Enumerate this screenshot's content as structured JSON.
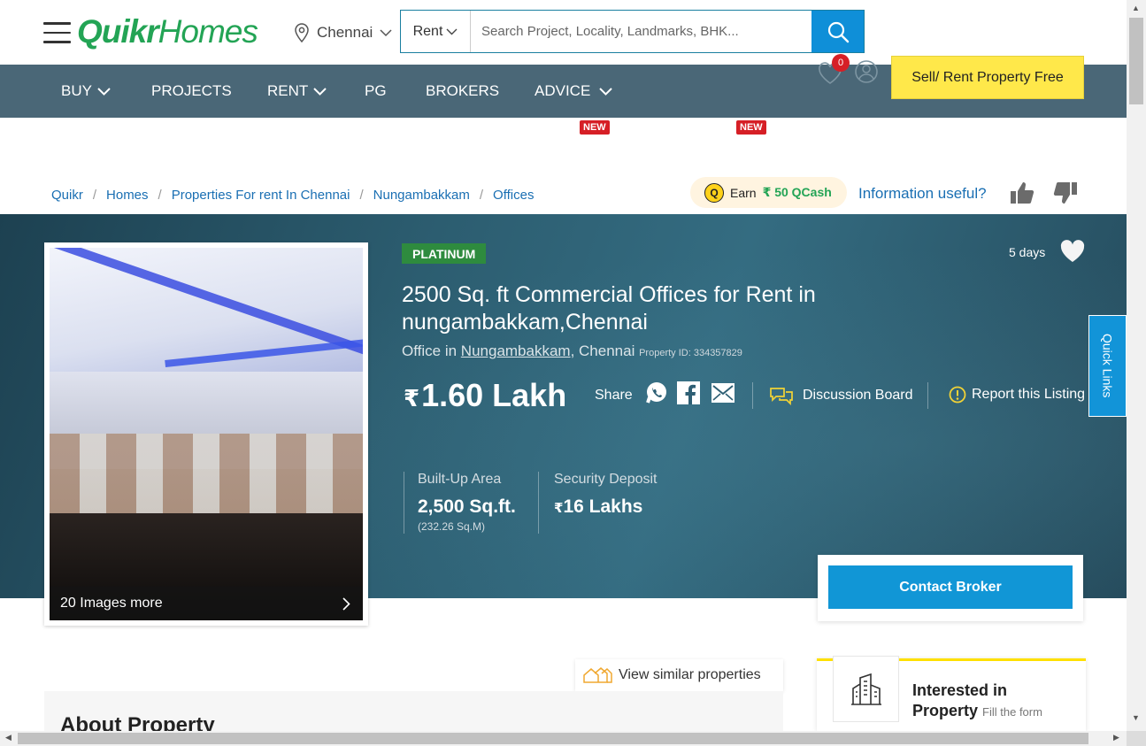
{
  "header": {
    "logo_quikr": "Quikr",
    "logo_homes": "Homes",
    "city": "Chennai",
    "search_type": "Rent",
    "search_placeholder": "Search Project, Locality, Landmarks, BHK...",
    "favorites_count": "0",
    "sell_button": "Sell/ Rent Property Free"
  },
  "nav": {
    "items": [
      {
        "label": "BUY",
        "has_dropdown": true
      },
      {
        "label": "PROJECTS",
        "has_dropdown": false
      },
      {
        "label": "RENT",
        "has_dropdown": true
      },
      {
        "label": "PG",
        "has_dropdown": false
      },
      {
        "label": "BROKERS",
        "has_dropdown": false
      },
      {
        "label": "ADVICE",
        "has_dropdown": true
      }
    ],
    "new_badge": "NEW"
  },
  "breadcrumb": [
    "Quikr",
    "Homes",
    "Properties For rent In Chennai",
    "Nungambakkam",
    "Offices"
  ],
  "qcash": {
    "prefix": "Earn",
    "amount": "₹ 50 QCash",
    "icon_letter": "Q"
  },
  "feedback": {
    "question": "Information useful?"
  },
  "listing": {
    "badge": "PLATINUM",
    "age": "5 days",
    "title": "2500 Sq. ft Commercial Offices for Rent in nungambakkam,Chennai",
    "type_prefix": "Office in",
    "locality": "Nungambakkam",
    "city_suffix": ", Chennai",
    "property_id": "Property ID: 334357829",
    "currency_symbol": "₹",
    "price": "1.60 Lakh",
    "share_label": "Share",
    "discussion": "Discussion Board",
    "report": "Report this Listing",
    "images_more": "20 Images more",
    "stats": {
      "builtup_label": "Built-Up Area",
      "builtup_value": "2,500 Sq.ft.",
      "builtup_sub": "(232.26 Sq.M)",
      "deposit_label": "Security Deposit",
      "deposit_value": "16 Lakhs"
    },
    "contact_button": "Contact Broker"
  },
  "quick_links": "Quick Links",
  "similar": "View similar properties",
  "about_title": "About Property",
  "interested": {
    "line1": "Interested in",
    "line2": "Property",
    "fill": "Fill the form"
  },
  "colors": {
    "brand_green": "#23a455",
    "nav_bg": "#4a6777",
    "link_blue": "#1a6fb3",
    "primary_blue": "#1196d6",
    "sell_yellow": "#ffe84a",
    "badge_red": "#d61f26",
    "platinum_green": "#2e8b3e"
  },
  "icons": [
    "menu-icon",
    "location-pin-icon",
    "chevron-down-icon",
    "search-icon",
    "heart-icon",
    "user-icon",
    "thumbs-up-icon",
    "thumbs-down-icon",
    "whatsapp-icon",
    "facebook-icon",
    "mail-icon",
    "chat-icon",
    "info-icon",
    "chevron-right-icon",
    "building-icon",
    "houses-icon"
  ]
}
